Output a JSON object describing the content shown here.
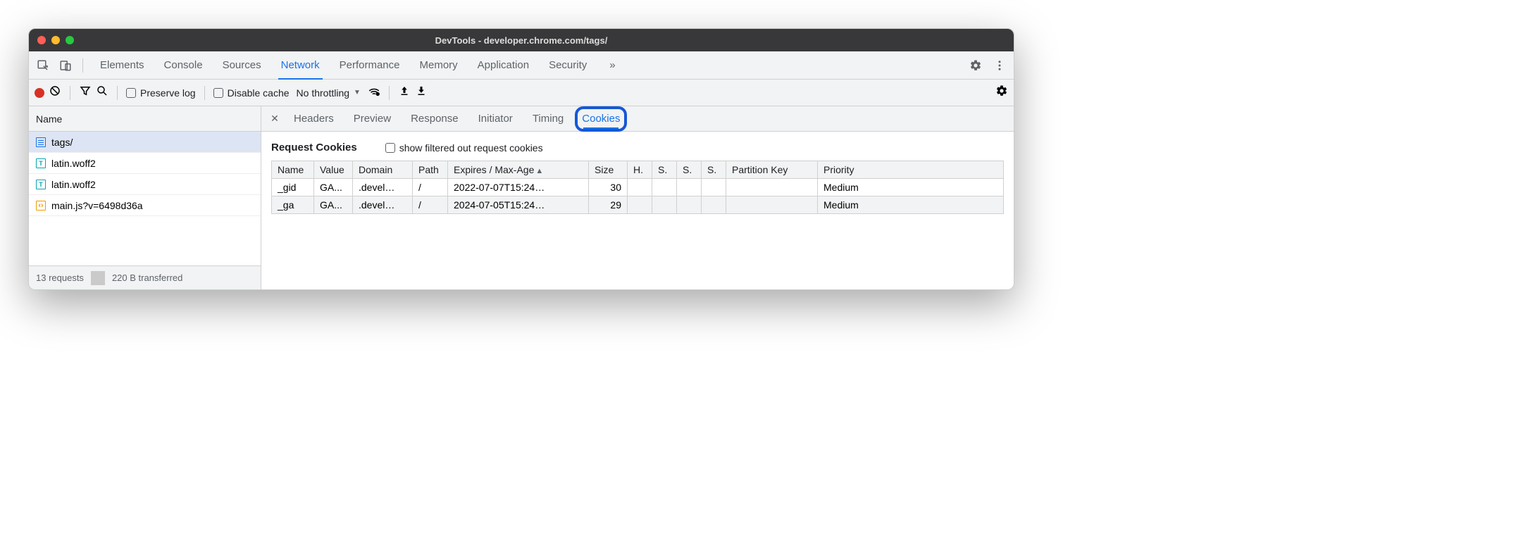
{
  "window": {
    "title": "DevTools - developer.chrome.com/tags/"
  },
  "tabs": {
    "items": [
      "Elements",
      "Console",
      "Sources",
      "Network",
      "Performance",
      "Memory",
      "Application",
      "Security"
    ],
    "active": "Network",
    "more": "»"
  },
  "toolbar": {
    "preserve_log": "Preserve log",
    "disable_cache": "Disable cache",
    "throttling": "No throttling"
  },
  "sidebar": {
    "header": "Name",
    "footer_requests": "13 requests",
    "footer_transferred": "220 B transferred",
    "requests": [
      {
        "name": "tags/",
        "type": "doc",
        "selected": true
      },
      {
        "name": "latin.woff2",
        "type": "font",
        "selected": false
      },
      {
        "name": "latin.woff2",
        "type": "font",
        "selected": false
      },
      {
        "name": "main.js?v=6498d36a",
        "type": "js",
        "selected": false
      }
    ]
  },
  "subtabs": {
    "items": [
      "Headers",
      "Preview",
      "Response",
      "Initiator",
      "Timing",
      "Cookies"
    ],
    "active": "Cookies"
  },
  "cookies_panel": {
    "title": "Request Cookies",
    "show_filtered": "show filtered out request cookies",
    "columns": [
      "Name",
      "Value",
      "Domain",
      "Path",
      "Expires / Max-Age",
      "Size",
      "H.",
      "S.",
      "S.",
      "S.",
      "Partition Key",
      "Priority"
    ],
    "sort_col": "Expires / Max-Age",
    "rows": [
      {
        "name": "_gid",
        "value": "GA...",
        "domain": ".devel…",
        "path": "/",
        "expires": "2022-07-07T15:24…",
        "size": "30",
        "h": "",
        "s1": "",
        "s2": "",
        "s3": "",
        "pk": "",
        "priority": "Medium"
      },
      {
        "name": "_ga",
        "value": "GA...",
        "domain": ".devel…",
        "path": "/",
        "expires": "2024-07-05T15:24…",
        "size": "29",
        "h": "",
        "s1": "",
        "s2": "",
        "s3": "",
        "pk": "",
        "priority": "Medium"
      }
    ]
  }
}
